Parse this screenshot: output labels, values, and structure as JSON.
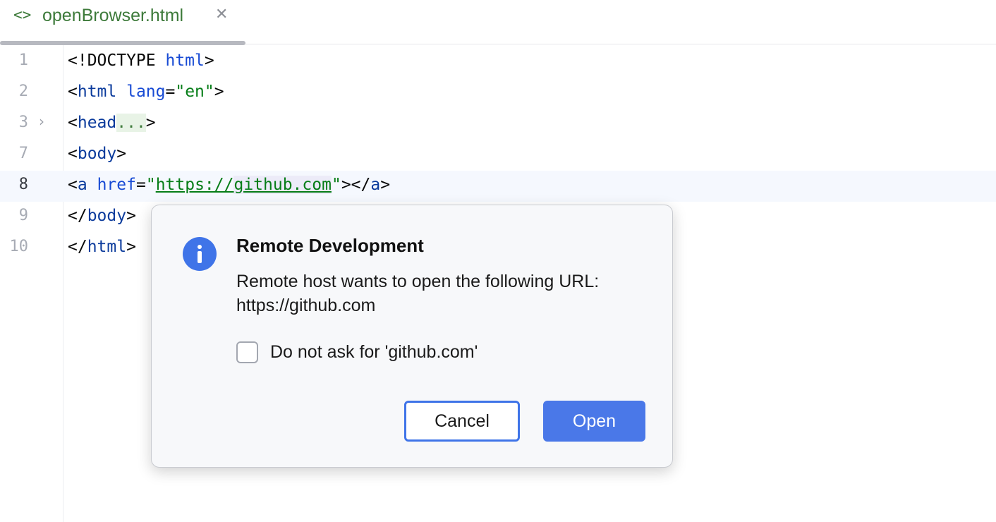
{
  "tab": {
    "icon": "html-file-icon",
    "icon_glyph": "<>",
    "title": "openBrowser.html",
    "close_glyph": "✕"
  },
  "editor": {
    "fold_glyph": "›",
    "lines": [
      {
        "number": "1"
      },
      {
        "number": "2"
      },
      {
        "number": "3"
      },
      {
        "number": "7"
      },
      {
        "number": "8"
      },
      {
        "number": "9"
      },
      {
        "number": "10"
      }
    ],
    "current_line": "8"
  },
  "dialog": {
    "icon": "info-icon",
    "title": "Remote Development",
    "message_line1": "Remote host wants to open the following URL:",
    "message_line2": "https://github.com",
    "checkbox_label": "Do not ask for 'github.com'",
    "checkbox_checked": false,
    "cancel_label": "Cancel",
    "open_label": "Open"
  },
  "colors": {
    "accent": "#3f74e8",
    "tag": "#0b3b9c",
    "attribute": "#174ad4",
    "string": "#067d17"
  }
}
